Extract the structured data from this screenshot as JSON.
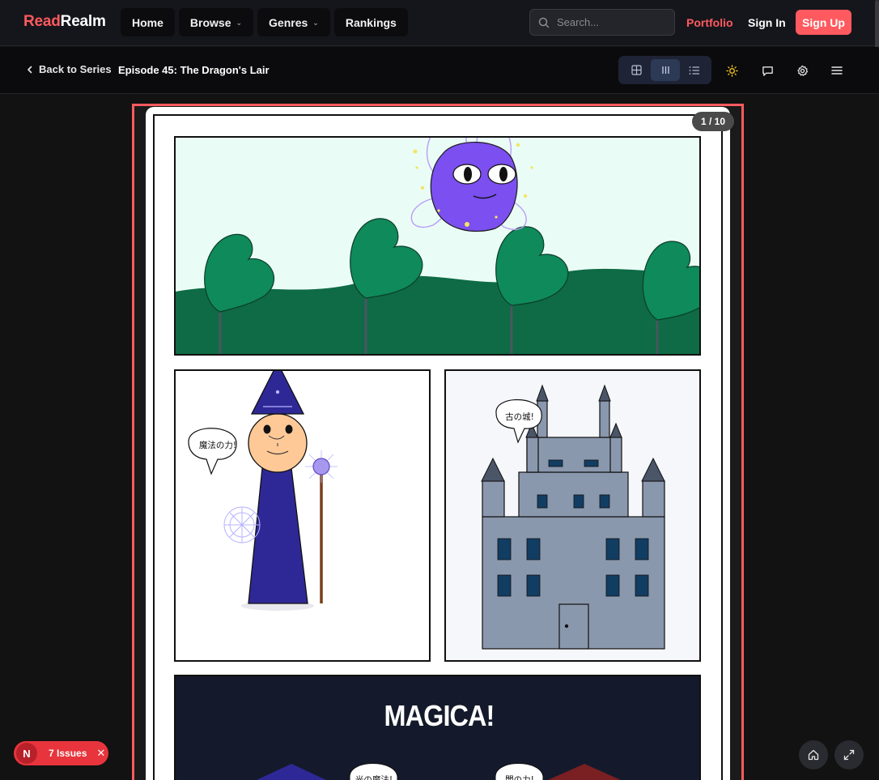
{
  "brand": {
    "part1": "Read",
    "part2": "Realm"
  },
  "nav": {
    "items": [
      {
        "label": "Home",
        "dropdown": false
      },
      {
        "label": "Browse",
        "dropdown": true
      },
      {
        "label": "Genres",
        "dropdown": true
      },
      {
        "label": "Rankings",
        "dropdown": false
      }
    ],
    "search_placeholder": "Search...",
    "portfolio": "Portfolio",
    "sign_in": "Sign In",
    "sign_up": "Sign Up"
  },
  "subbar": {
    "back_label": "Back to Series",
    "episode_title": "Episode 45: The Dragon's Lair",
    "view_modes": [
      "grid-view-icon",
      "vertical-scroll-icon",
      "list-view-icon"
    ],
    "active_view": "vertical-scroll-icon",
    "tools": [
      "sun-icon",
      "comment-icon",
      "settings-icon",
      "menu-icon"
    ]
  },
  "reader": {
    "page_counter": "1 / 10",
    "panel2_bubble": "魔法の力!",
    "panel3_bubble": "古の城!",
    "panel4_title": "MAGICA!",
    "panel4_bubble_left": "光の魔法!",
    "panel4_bubble_right": "闇の力!"
  },
  "issues": {
    "badge": "N",
    "label": "7 Issues"
  },
  "floating": [
    "home-icon",
    "expand-icon"
  ],
  "colors": {
    "accent": "#ff5a5f",
    "background": "#121212",
    "navbar": "#15161b"
  }
}
